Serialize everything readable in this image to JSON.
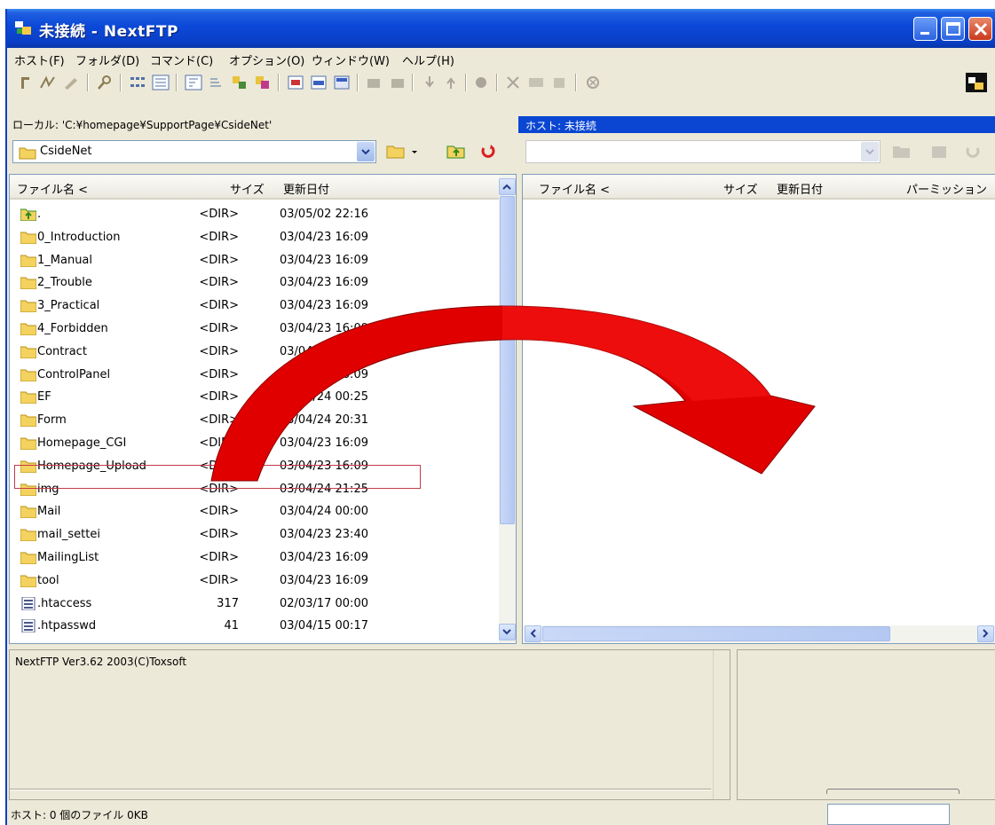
{
  "window": {
    "title": "未接続 - NextFTP"
  },
  "menu": [
    "ホスト(F)",
    "フォルダ(D)",
    "コマンド(C)",
    "オプション(O)",
    "ウィンドウ(W)",
    "ヘルプ(H)"
  ],
  "paths": {
    "local": "ローカル: 'C:¥homepage¥SupportPage¥CsideNet'",
    "host": "ホスト: 未接続"
  },
  "local_combo": {
    "value": "CsideNet"
  },
  "local_list": {
    "columns": [
      "ファイル名 <",
      "サイズ",
      "更新日付"
    ],
    "rows": [
      {
        "name": ".",
        "size": "<DIR>",
        "date": "03/05/02 22:16",
        "icon": "folder-up-icon"
      },
      {
        "name": "0_Introduction",
        "size": "<DIR>",
        "date": "03/04/23 16:09",
        "icon": "folder-icon"
      },
      {
        "name": "1_Manual",
        "size": "<DIR>",
        "date": "03/04/23 16:09",
        "icon": "folder-icon"
      },
      {
        "name": "2_Trouble",
        "size": "<DIR>",
        "date": "03/04/23 16:09",
        "icon": "folder-icon"
      },
      {
        "name": "3_Practical",
        "size": "<DIR>",
        "date": "03/04/23 16:09",
        "icon": "folder-icon"
      },
      {
        "name": "4_Forbidden",
        "size": "<DIR>",
        "date": "03/04/23 16:09",
        "icon": "folder-icon"
      },
      {
        "name": "Contract",
        "size": "<DIR>",
        "date": "03/04/23 16:09",
        "icon": "folder-icon"
      },
      {
        "name": "ControlPanel",
        "size": "<DIR>",
        "date": "03/04/23 16:09",
        "icon": "folder-icon"
      },
      {
        "name": "EF",
        "size": "<DIR>",
        "date": "03/04/24 00:25",
        "icon": "folder-icon"
      },
      {
        "name": "Form",
        "size": "<DIR>",
        "date": "03/04/24 20:31",
        "icon": "folder-icon"
      },
      {
        "name": "Homepage_CGI",
        "size": "<DIR>",
        "date": "03/04/23 16:09",
        "icon": "folder-icon"
      },
      {
        "name": "Homepage_Upload",
        "size": "<DIR>",
        "date": "03/04/23 16:09",
        "icon": "folder-icon"
      },
      {
        "name": "img",
        "size": "<DIR>",
        "date": "03/04/24 21:25",
        "icon": "folder-icon"
      },
      {
        "name": "Mail",
        "size": "<DIR>",
        "date": "03/04/24 00:00",
        "icon": "folder-icon"
      },
      {
        "name": "mail_settei",
        "size": "<DIR>",
        "date": "03/04/23 23:40",
        "icon": "folder-icon"
      },
      {
        "name": "MailingList",
        "size": "<DIR>",
        "date": "03/04/23 16:09",
        "icon": "folder-icon"
      },
      {
        "name": "tool",
        "size": "<DIR>",
        "date": "03/04/23 16:09",
        "icon": "folder-icon"
      },
      {
        "name": ".htaccess",
        "size": "317",
        "date": "02/03/17 00:00",
        "icon": "file-icon"
      },
      {
        "name": ".htpasswd",
        "size": "41",
        "date": "03/04/15 00:17",
        "icon": "file-icon"
      }
    ]
  },
  "remote_list": {
    "columns": [
      "ファイル名 <",
      "サイズ",
      "更新日付",
      "パーミッション"
    ]
  },
  "log": {
    "text": "NextFTP Ver3.62 2003(C)Toxsoft"
  },
  "status": {
    "text": "ホスト: 0 個のファイル  0KB"
  },
  "colors": {
    "titlebar": "#0a3fc6",
    "host_bar": "#0a46d2",
    "arrow": "#e00000",
    "highlight": "#c43a4a"
  }
}
